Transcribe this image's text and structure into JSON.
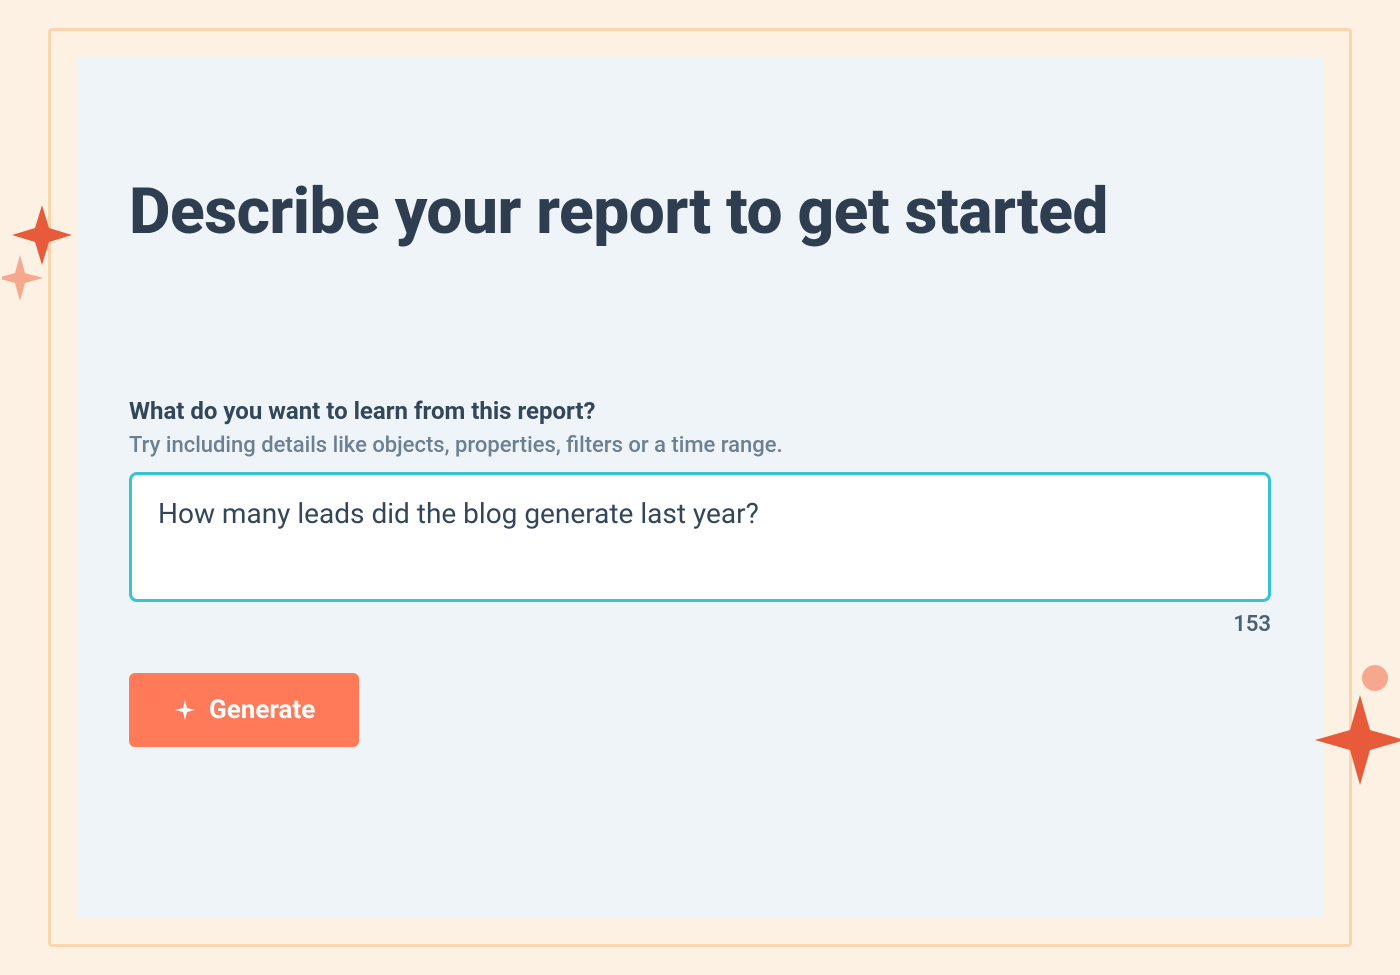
{
  "title": "Describe your report to get started",
  "prompt": {
    "label": "What do you want to learn from this report?",
    "hint": "Try including details like objects, properties, filters or a time range.",
    "value": "How many leads did the blog generate last year?",
    "char_count": "153"
  },
  "generate_label": "Generate",
  "colors": {
    "accent": "#ff7a59",
    "focus_ring": "#36c3d4",
    "panel_bg": "#eef4f7",
    "page_bg": "#fdf1e4",
    "frame_border": "#fbd5b0",
    "text_primary": "#2e3d4f",
    "text_secondary": "#6c8093"
  }
}
